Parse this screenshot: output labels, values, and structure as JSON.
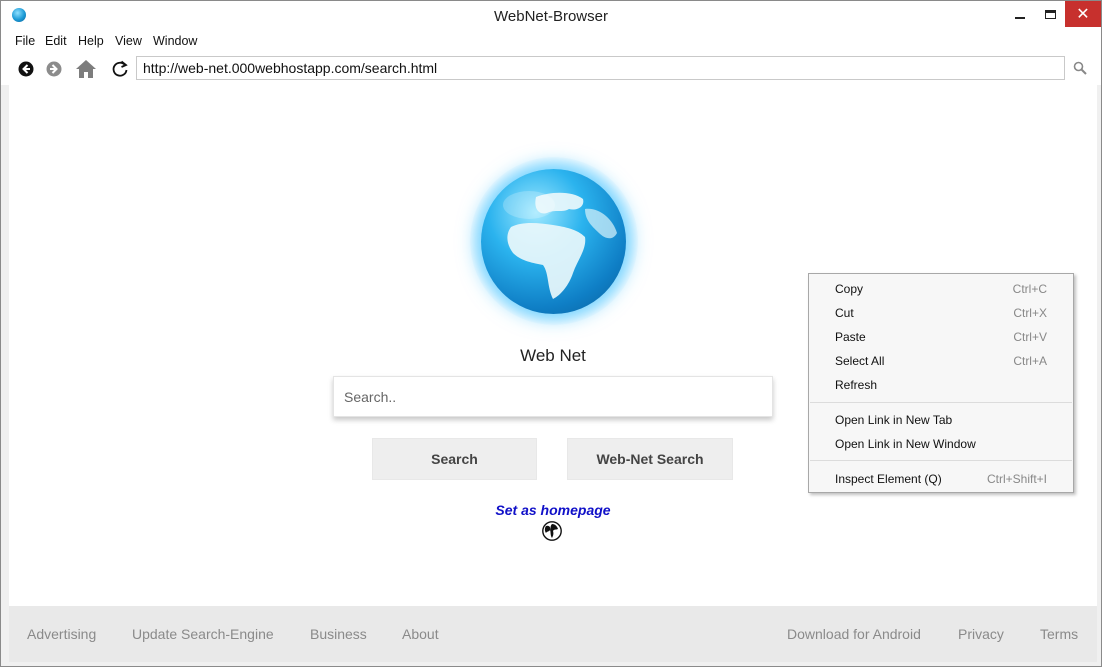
{
  "window": {
    "title": "WebNet-Browser",
    "close_glyph": "✕"
  },
  "menu": [
    "File",
    "Edit",
    "Help",
    "View",
    "Window"
  ],
  "navbar": {
    "url": "http://web-net.000webhostapp.com/search.html",
    "icons": [
      "back-icon",
      "forward-icon",
      "home-icon",
      "refresh-icon",
      "search-icon"
    ]
  },
  "page": {
    "site_name": "Web Net",
    "search_placeholder": "Search..",
    "search_button": "Search",
    "webnet_search_button": "Web-Net Search",
    "homepage_link": "Set as homepage"
  },
  "footer": {
    "left": [
      "Advertising",
      "Update Search-Engine",
      "Business",
      "About"
    ],
    "right": [
      "Download for Android",
      "Privacy",
      "Terms"
    ]
  },
  "context_menu": [
    {
      "label": "Copy",
      "shortcut": "Ctrl+C"
    },
    {
      "label": "Cut",
      "shortcut": "Ctrl+X"
    },
    {
      "label": "Paste",
      "shortcut": "Ctrl+V"
    },
    {
      "label": "Select All",
      "shortcut": "Ctrl+A"
    },
    {
      "label": "Refresh",
      "shortcut": ""
    },
    {
      "label": "Open Link in New Tab",
      "shortcut": ""
    },
    {
      "label": "Open Link in New Window",
      "shortcut": ""
    },
    {
      "label": "Inspect Element (Q)",
      "shortcut": "Ctrl+Shift+I"
    }
  ],
  "colors": {
    "close_button": "#c7302d",
    "link": "#1010c8",
    "globe": "#1b9ad6"
  }
}
